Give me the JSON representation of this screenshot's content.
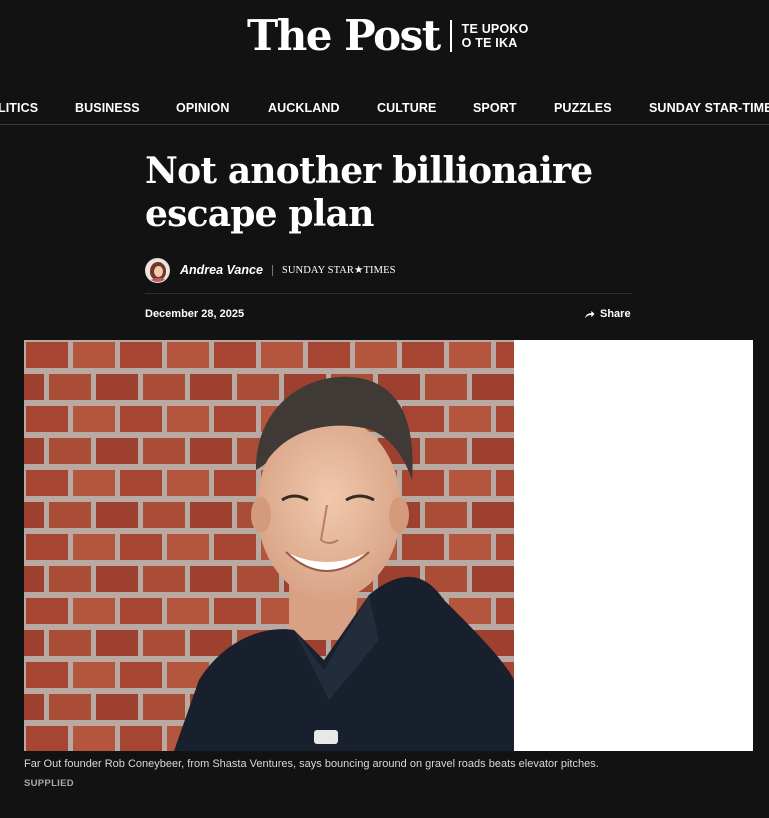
{
  "masthead": {
    "logo": "The Post",
    "sub_line_1": "TE UPOKO",
    "sub_line_2": "O TE IKA"
  },
  "nav": {
    "items": [
      "LITICS",
      "BUSINESS",
      "OPINION",
      "AUCKLAND",
      "CULTURE",
      "SPORT",
      "PUZZLES",
      "SUNDAY STAR-TIMES"
    ]
  },
  "article": {
    "headline": "Not another billionaire escape plan",
    "author": "Andrea Vance",
    "publication": "SUNDAY STAR★TIMES",
    "date": "December 28, 2025",
    "share_label": "Share",
    "caption": "Far Out founder Rob Coneybeer, from Shasta Ventures, says bouncing around on gravel roads beats elevator pitches.",
    "credit": "SUPPLIED"
  },
  "icons": {
    "share": "share-arrow-icon",
    "avatar": "author-avatar"
  },
  "colors": {
    "background": "#121212",
    "text": "#ffffff",
    "caption": "#d8d8d8",
    "credit": "#a8a8a8"
  }
}
